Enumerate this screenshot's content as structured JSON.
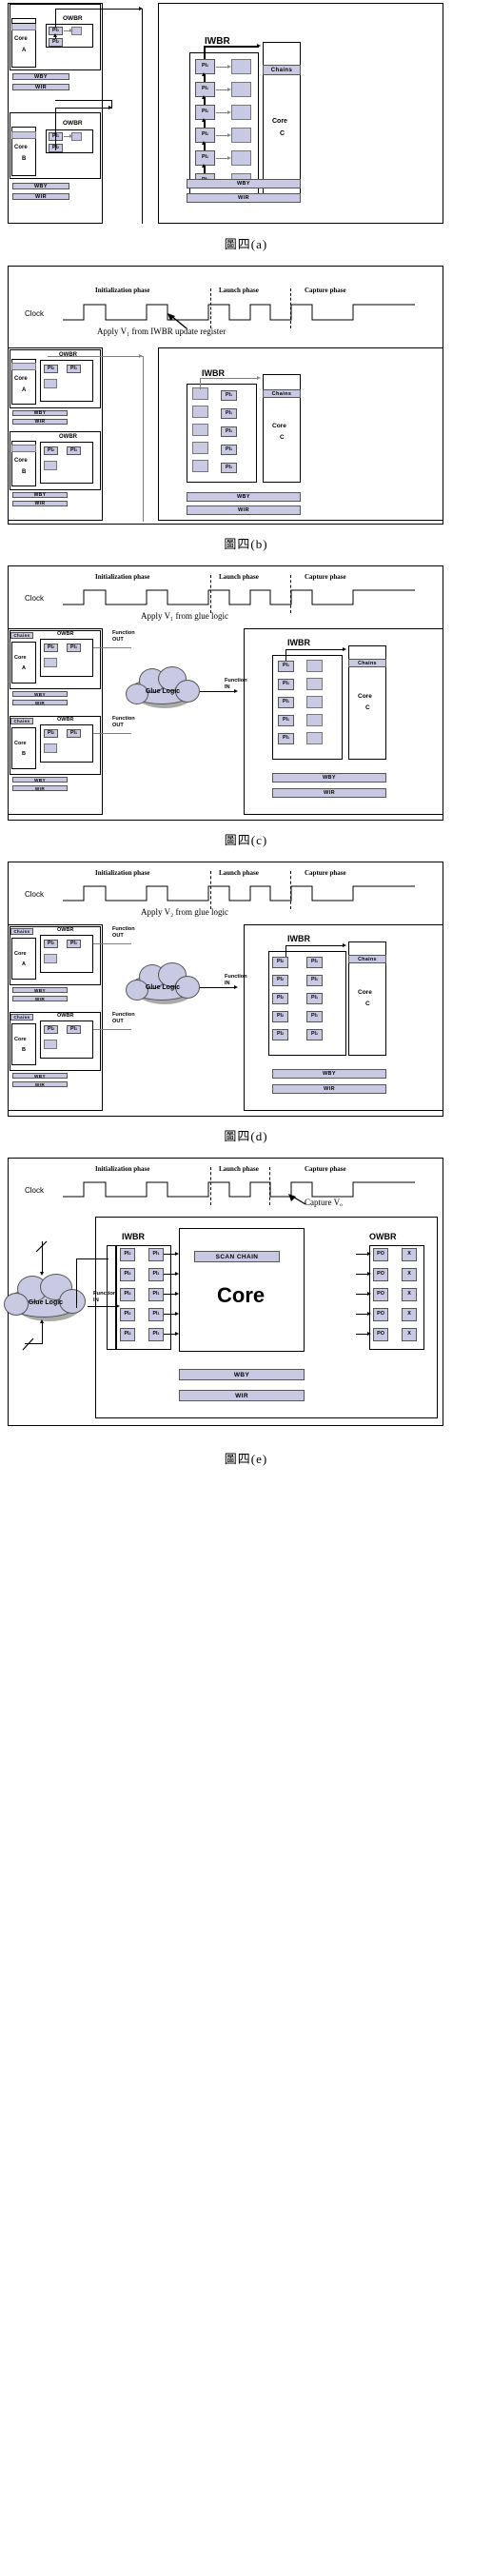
{
  "figures": [
    {
      "id": "fig-a",
      "caption": "圖四(a)",
      "has_clock": false,
      "labels": {
        "owbr": "OWBR",
        "iwbr": "IWBR",
        "wby": "WBY",
        "wir": "WIR",
        "chains": "Chains",
        "core_a": "Core",
        "core_a_sub": "A",
        "core_b": "Core",
        "core_b_sub": "B",
        "core_c": "Core",
        "core_c_sub": "C",
        "pi1": "PI",
        "pi1_sub": "1",
        "pi2": "PI",
        "pi2_sub": "2"
      }
    },
    {
      "id": "fig-b",
      "caption": "圖四(b)",
      "has_clock": true,
      "clock": {
        "label": "Clock",
        "phases": [
          "Initialization phase",
          "Launch phase",
          "Capture phase"
        ],
        "annotation": "Apply V₁ from IWBR update register"
      },
      "labels": {
        "owbr": "OWBR",
        "iwbr": "IWBR",
        "wby": "WBY",
        "wir": "WIR",
        "chains": "Chains",
        "core_a": "Core",
        "core_a_sub": "A",
        "core_b": "Core",
        "core_b_sub": "B",
        "core_c": "Core",
        "core_c_sub": "C"
      }
    },
    {
      "id": "fig-c",
      "caption": "圖四(c)",
      "has_clock": true,
      "clock": {
        "label": "Clock",
        "phases": [
          "Initialization phase",
          "Launch phase",
          "Capture phase"
        ],
        "annotation": "Apply V₁ from glue logic"
      },
      "labels": {
        "owbr": "OWBR",
        "iwbr": "IWBR",
        "wby": "WBY",
        "wir": "WIR",
        "chains": "Chains",
        "glue": "Glue Logic",
        "function_out": "Function\nOUT",
        "function_in": "Function\nIN",
        "core_a": "Core",
        "core_a_sub": "A",
        "core_b": "Core",
        "core_b_sub": "B",
        "core_c": "Core",
        "core_c_sub": "C"
      }
    },
    {
      "id": "fig-d",
      "caption": "圖四(d)",
      "has_clock": true,
      "clock": {
        "label": "Clock",
        "phases": [
          "Initialization phase",
          "Launch phase",
          "Capture phase"
        ],
        "annotation": "Apply V₂ from glue logic"
      },
      "labels": {
        "owbr": "OWBR",
        "iwbr": "IWBR",
        "wby": "WBY",
        "wir": "WIR",
        "chains": "Chains",
        "glue": "Glue Logic",
        "function_out": "Function\nOUT",
        "function_in": "Function\nIN",
        "core_a": "Core",
        "core_a_sub": "A",
        "core_b": "Core",
        "core_b_sub": "B",
        "core_c": "Core",
        "core_c_sub": "C"
      }
    },
    {
      "id": "fig-e",
      "caption": "圖四(e)",
      "has_clock": true,
      "clock": {
        "label": "Clock",
        "phases": [
          "Initialization phase",
          "Launch phase",
          "Capture phase"
        ],
        "annotation": "Capture Vₒ"
      },
      "labels": {
        "iwbr": "IWBR",
        "owbr": "OWBR",
        "scan_chain": "SCAN CHAIN",
        "core": "Core",
        "wby": "WBY",
        "wir": "WIR",
        "glue": "Glue Logic",
        "function_in": "Function\nIN",
        "po": "PO",
        "x": "X",
        "pi1": "PI",
        "pi1_sub": "1",
        "pi2": "PI",
        "pi2_sub": "2"
      }
    }
  ],
  "colors": {
    "cell_fill": "#c9c9e4",
    "cell_border": "#555555",
    "line": "#000000",
    "line_gray": "#808080",
    "background": "#ffffff"
  }
}
